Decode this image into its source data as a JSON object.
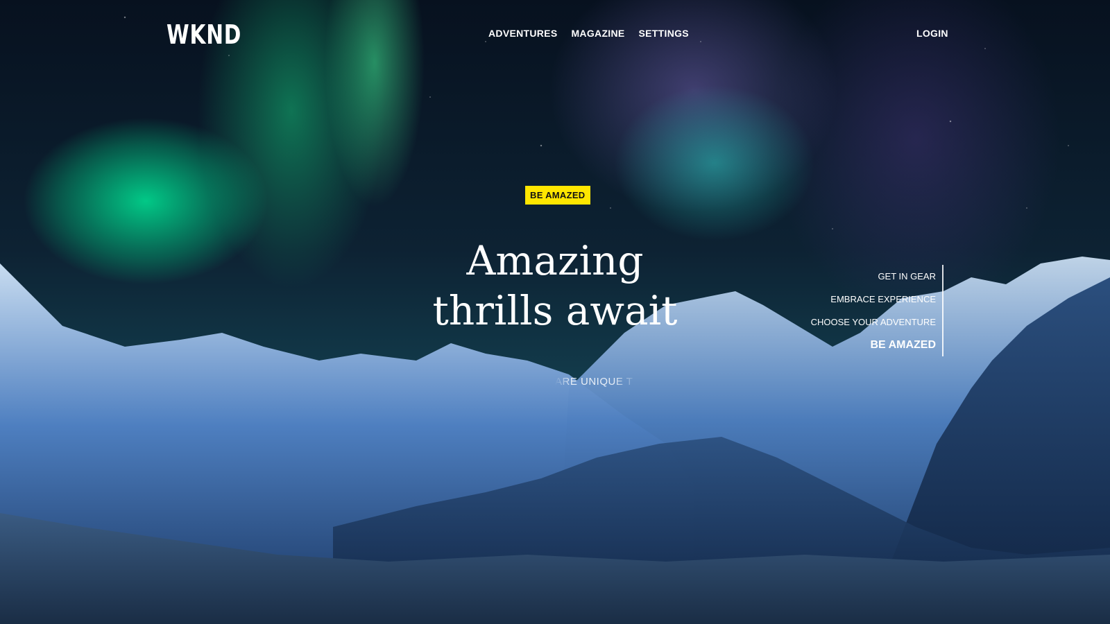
{
  "header": {
    "logo": "WKND",
    "nav": [
      "ADVENTURES",
      "MAGAZINE",
      "SETTINGS"
    ],
    "login": "LOGIN"
  },
  "hero": {
    "badge": "BE AMAZED",
    "title_line1": "Amazing",
    "title_line2": "thrills await",
    "subline": "ARE UNIQUE T"
  },
  "carousel": {
    "items": [
      "GET IN GEAR",
      "EMBRACE EXPERIENCE",
      "CHOOSE YOUR ADVENTURE",
      "BE AMAZED"
    ],
    "active_index": 3
  },
  "colors": {
    "badge_bg": "#ffe600",
    "text": "#ffffff"
  }
}
